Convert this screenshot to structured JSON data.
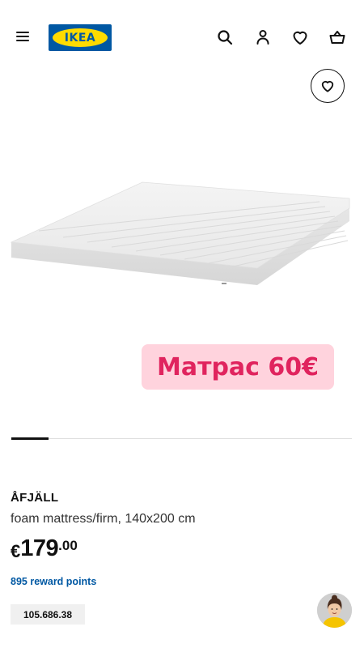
{
  "header": {
    "logo_text": "IKEA",
    "icons": [
      "menu-icon",
      "search-icon",
      "user-icon",
      "heart-icon",
      "basket-icon"
    ],
    "brand_colors": {
      "blue": "#0058a3",
      "yellow": "#ffdb00"
    }
  },
  "promo": {
    "label": "Матрас 60€",
    "background": "#ffd3dd",
    "color": "#e0245e"
  },
  "carousel": {
    "current_index": 1,
    "progress": 0.11
  },
  "product": {
    "name": "ÅFJÄLL",
    "description": "foam mattress/firm, 140x200 cm",
    "price_currency": "€",
    "price_integer": "179",
    "price_decimal": ".00",
    "reward_points": "895 reward points",
    "article_number": "105.686.38"
  }
}
